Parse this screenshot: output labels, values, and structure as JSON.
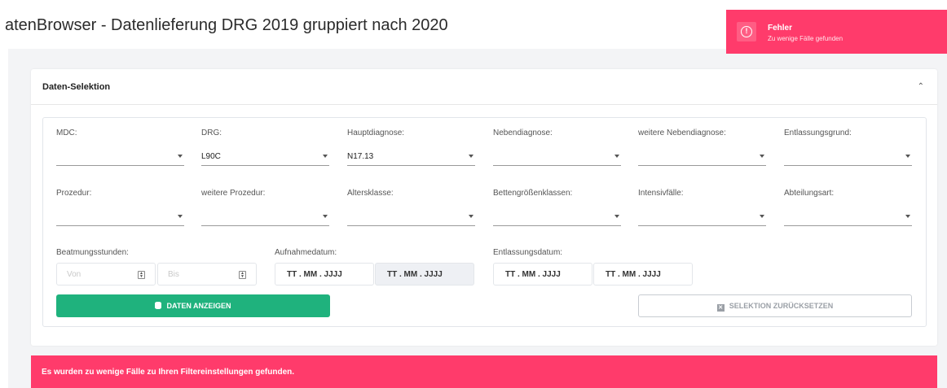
{
  "page": {
    "title": "atenBrowser - Datenlieferung DRG 2019 gruppiert nach 2020"
  },
  "card": {
    "title": "Daten-Selektion",
    "collapse_icon": "chevron-up-icon"
  },
  "filters_row1": [
    {
      "label": "MDC:",
      "value": ""
    },
    {
      "label": "DRG:",
      "value": "L90C"
    },
    {
      "label": "Hauptdiagnose:",
      "value": "N17.13"
    },
    {
      "label": "Nebendiagnose:",
      "value": ""
    },
    {
      "label": "weitere Nebendiagnose:",
      "value": ""
    },
    {
      "label": "Entlassungsgrund:",
      "value": ""
    }
  ],
  "filters_row2": [
    {
      "label": "Prozedur:",
      "value": ""
    },
    {
      "label": "weitere Prozedur:",
      "value": ""
    },
    {
      "label": "Altersklasse:",
      "value": ""
    },
    {
      "label": "Bettengrößenklassen:",
      "value": ""
    },
    {
      "label": "Intensivfälle:",
      "value": ""
    },
    {
      "label": "Abteilungsart:",
      "value": ""
    }
  ],
  "beatmung": {
    "label": "Beatmungsstunden:",
    "from_placeholder": "Von",
    "to_placeholder": "Bis"
  },
  "aufnahme": {
    "label": "Aufnahmedatum:",
    "from": "TT . MM . JJJJ",
    "to": "TT . MM . JJJJ"
  },
  "entlassung": {
    "label": "Entlassungsdatum:",
    "from": "TT . MM . JJJJ",
    "to": "TT . MM . JJJJ"
  },
  "buttons": {
    "show": "DATEN ANZEIGEN",
    "reset": "SELEKTION ZURÜCKSETZEN"
  },
  "error_bar": {
    "text": "Es wurden zu wenige Fälle zu Ihren Filtereinstellungen gefunden."
  },
  "toast": {
    "title": "Fehler",
    "message": "Zu wenige Fälle gefunden",
    "icon": "alert-circle-icon"
  },
  "colors": {
    "primary": "#1fb27d",
    "error": "#ff3b6b"
  }
}
